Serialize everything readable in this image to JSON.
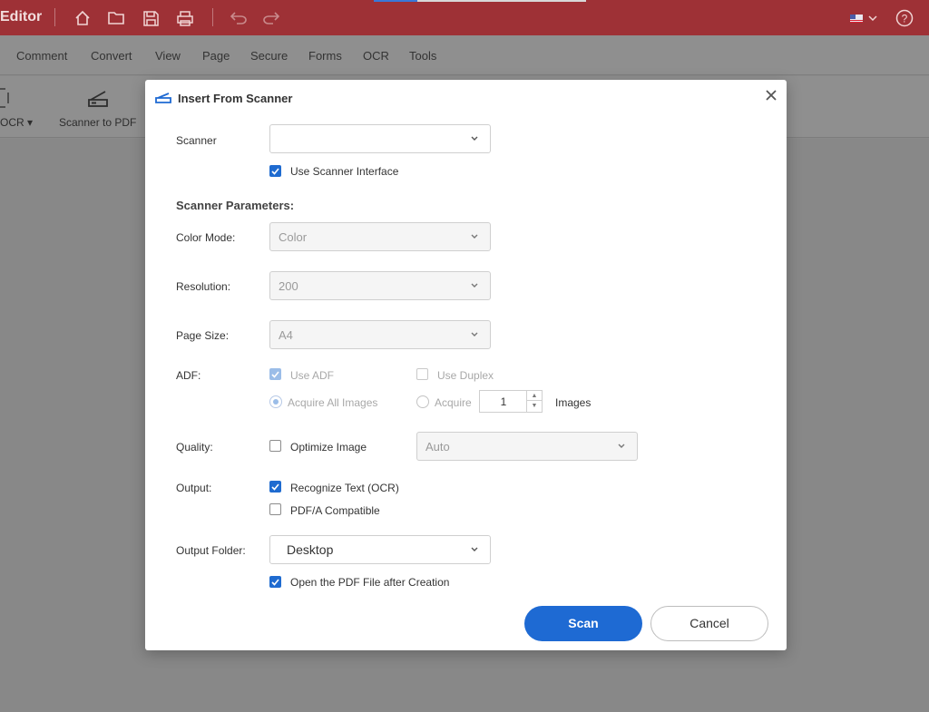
{
  "app": {
    "title": "Editor"
  },
  "menu": [
    "Comment",
    "Convert",
    "View",
    "Page",
    "Secure",
    "Forms",
    "OCR",
    "Tools"
  ],
  "ribbon": {
    "ocr_label": "OCR ▾",
    "scanner_to_pdf": "Scanner to PDF"
  },
  "dialog": {
    "title": "Insert From Scanner",
    "scanner_label": "Scanner",
    "scanner_value": "",
    "use_scanner_interface": "Use Scanner Interface",
    "params_heading": "Scanner Parameters:",
    "color_mode_label": "Color Mode:",
    "color_mode_value": "Color",
    "resolution_label": "Resolution:",
    "resolution_value": "200",
    "page_size_label": "Page Size:",
    "page_size_value": "A4",
    "adf_label": "ADF:",
    "use_adf": "Use ADF",
    "use_duplex": "Use Duplex",
    "acquire_all": "Acquire All Images",
    "acquire": "Acquire",
    "acquire_count": "1",
    "images": "Images",
    "quality_label": "Quality:",
    "optimize_image": "Optimize Image",
    "quality_value": "Auto",
    "output_label": "Output:",
    "recognize_text": "Recognize Text (OCR)",
    "pdfa": "PDF/A Compatible",
    "output_folder_label": "Output Folder:",
    "output_folder_value": "Desktop",
    "open_pdf": "Open the PDF File after Creation",
    "scan_button": "Scan",
    "cancel_button": "Cancel"
  },
  "colors": {
    "titlebar": "#9e3136",
    "accent": "#1e6ad3",
    "annotation_arrow": "#c0282f"
  }
}
